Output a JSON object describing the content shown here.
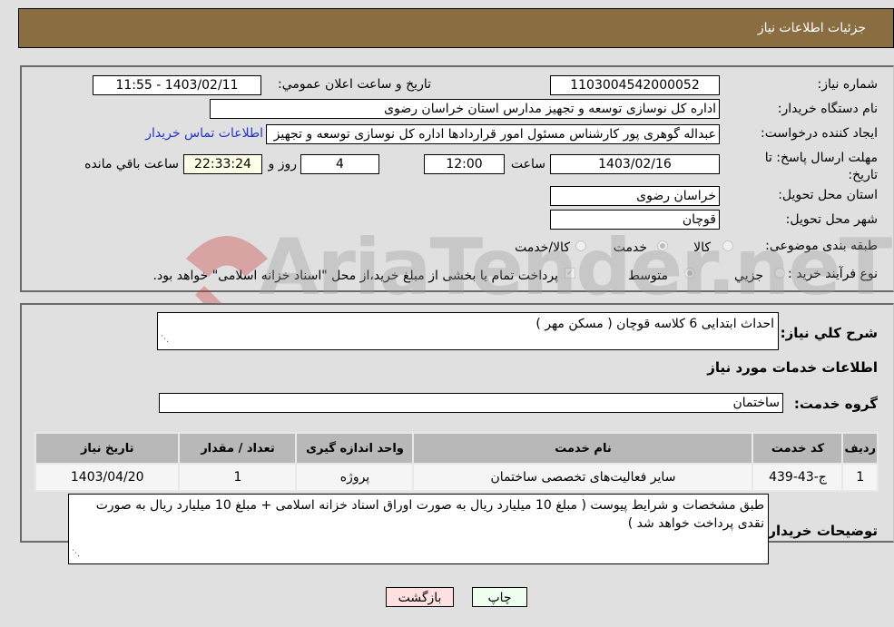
{
  "header": {
    "title": "جزئیات اطلاعات نیاز"
  },
  "form": {
    "need_number_label": "شماره نیاز:",
    "need_number": "1103004542000052",
    "announce_label": "تاریخ و ساعت اعلان عمومي:",
    "announce_value": "1403/02/11 - 11:55",
    "buyer_org_label": "نام دستگاه خریدار:",
    "buyer_org": "اداره کل نوسازی  توسعه و تجهیز مدارس استان خراسان رضوی",
    "creator_label": "ایجاد کننده درخواست:",
    "creator": "عبداله گوهری پور کارشناس مسئول امور قراردادها  اداره کل نوسازی  توسعه و تجهیز",
    "contact_link": "اطلاعات تماس خریدار",
    "deadline_label": "مهلت ارسال پاسخ: تا تاریخ:",
    "deadline_date": "1403/02/16",
    "time_label": "ساعت",
    "deadline_time": "12:00",
    "days_value": "4",
    "days_label": "روز و",
    "remaining_time": "22:33:24",
    "remaining_label": "ساعت باقي مانده",
    "province_label": "استان محل تحویل:",
    "province": "خراسان رضوی",
    "city_label": "شهر محل تحویل:",
    "city": "قوچان",
    "category_label": "طبقه بندی موضوعی:",
    "category_options": [
      "کالا",
      "خدمت",
      "کالا/خدمت"
    ],
    "category_selected": "خدمت",
    "process_label": "نوع فرآیند خرید :",
    "process_options": [
      "جزيي",
      "متوسط"
    ],
    "process_selected": "متوسط",
    "payment_note": "پرداخت تمام یا بخشی از مبلغ خرید،از محل \"اسناد خزانه اسلامی\" خواهد بود."
  },
  "details": {
    "summary_label": "شرح کلي نیاز:",
    "summary": "احداث ابتدایی 6 کلاسه قوچان ( مسکن مهر )",
    "services_heading": "اطلاعات خدمات مورد نیاز",
    "service_group_label": "گروه خدمت:",
    "service_group": "ساختمان",
    "table": {
      "headers": [
        "ردیف",
        "کد خدمت",
        "نام خدمت",
        "واحد اندازه گیری",
        "تعداد / مقدار",
        "تاریخ نیاز"
      ],
      "rows": [
        [
          "1",
          "ج-43-439",
          "سایر فعالیت‌های تخصصی ساختمان",
          "پروژه",
          "1",
          "1403/04/20"
        ]
      ]
    },
    "buyer_notes_label": "توضیحات خریدار:",
    "buyer_notes": "طبق مشخصات و شرایط پیوست ( مبلغ 10 میلیارد ریال به صورت اوراق اسناد خزانه اسلامی + مبلغ 10 میلیارد ریال به صورت نقدی پرداخت خواهد شد )"
  },
  "buttons": {
    "print": "چاپ",
    "back": "بازگشت"
  },
  "watermark": "AriaTender.neT",
  "colors": {
    "header": "#8b6d42",
    "link": "#2233cc",
    "print_bg": "#efffef",
    "back_bg": "#ffe0e0"
  }
}
